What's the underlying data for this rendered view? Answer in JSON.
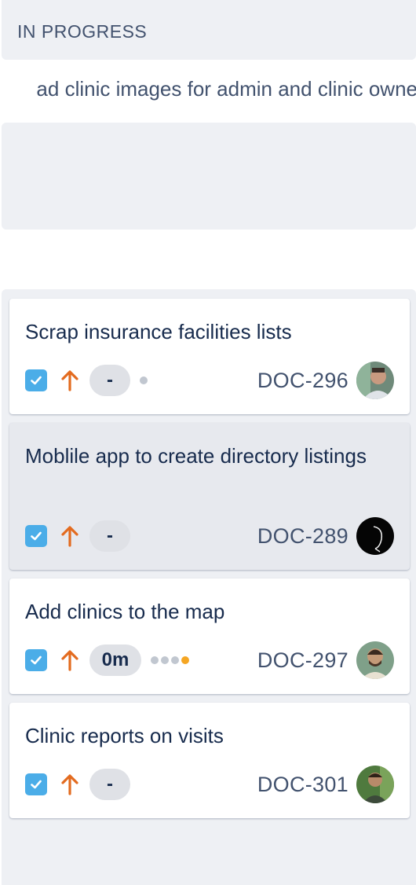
{
  "column": {
    "header": "IN PROGRESS"
  },
  "epic_line": "ad clinic images for admin and clinic owne",
  "colors": {
    "checkbox": "#4bade8",
    "priority_high": "#e36b1f",
    "pill_bg": "#dfe1e6",
    "key_text": "#42526e"
  },
  "cards": [
    {
      "title": "Scrap insurance facilities lists",
      "type_icon": "checkbox-icon",
      "priority_icon": "priority-arrow-up-icon",
      "estimate": "-",
      "key": "DOC-296",
      "avatar": "avatar-person-icon"
    },
    {
      "title": "Moblile app to create directory listings",
      "type_icon": "checkbox-icon",
      "priority_icon": "priority-arrow-up-icon",
      "estimate": "-",
      "key": "DOC-289",
      "avatar": "avatar-dark-icon"
    },
    {
      "title": "Add clinics to the map",
      "type_icon": "checkbox-icon",
      "priority_icon": "priority-arrow-up-icon",
      "estimate": "0m",
      "key": "DOC-297",
      "avatar": "avatar-person-icon"
    },
    {
      "title": "Clinic reports on visits",
      "type_icon": "checkbox-icon",
      "priority_icon": "priority-arrow-up-icon",
      "estimate": "-",
      "key": "DOC-301",
      "avatar": "avatar-person-icon"
    }
  ]
}
